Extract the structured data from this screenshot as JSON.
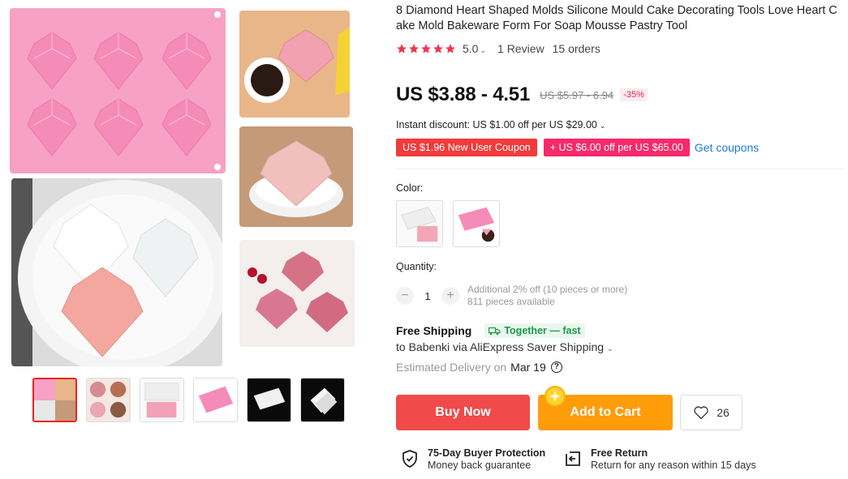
{
  "product": {
    "title": "8 Diamond Heart Shaped Molds Silicone Mould Cake Decorating Tools Love Heart Cake Mold Bakeware Form For Soap Mousse Pastry Tool",
    "rating": "5.0",
    "stars": 5,
    "reviews": "1 Review",
    "orders": "15 orders"
  },
  "price": {
    "current": "US $3.88 - 4.51",
    "original": "US $5.97 - 6.94",
    "discount": "-35%",
    "instant_discount": "Instant discount: US $1.00 off per US $29.00"
  },
  "coupons": {
    "new_user": "US $1.96 New User Coupon",
    "store": "+ US $6.00 off per US $65.00",
    "get_link": "Get coupons"
  },
  "variants": {
    "color_label": "Color:",
    "quantity_label": "Quantity:",
    "quantity_value": "1",
    "minus": "−",
    "plus": "+",
    "bulk_note": "Additional 2% off (10 pieces or more)",
    "available": "811 pieces available"
  },
  "shipping": {
    "title": "Free Shipping",
    "tag": "Together — fast",
    "route": "to Babenki via AliExpress Saver Shipping",
    "delivery_label": "Estimated Delivery on",
    "delivery_date": "Mar 19",
    "help": "?"
  },
  "actions": {
    "buy_now": "Buy Now",
    "add_to_cart": "Add to Cart",
    "wishlist_count": "26"
  },
  "guarantees": {
    "protection_title": "75-Day Buyer Protection",
    "protection_sub": "Money back guarantee",
    "return_title": "Free Return",
    "return_sub": "Return for any reason within 15 days"
  },
  "colors": {
    "pink": "#f7a1c4",
    "accent_red": "#f04a4a",
    "accent_orange": "#ff9c0a",
    "star": "#f2344f",
    "link": "#1d7ad8",
    "green": "#1a9a4a"
  }
}
